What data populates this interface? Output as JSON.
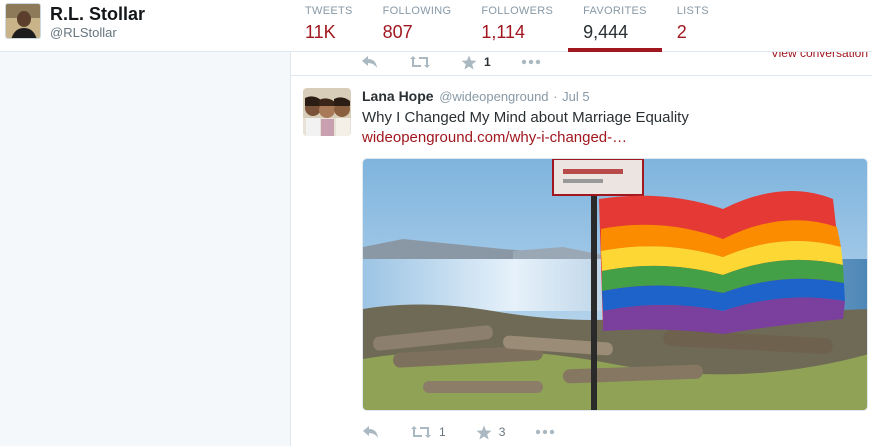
{
  "profile": {
    "name": "R.L. Stollar",
    "handle": "@RLStollar"
  },
  "stats": [
    {
      "label": "TWEETS",
      "value": "11K",
      "active": false
    },
    {
      "label": "FOLLOWING",
      "value": "807",
      "active": false
    },
    {
      "label": "FOLLOWERS",
      "value": "1,114",
      "active": false
    },
    {
      "label": "FAVORITES",
      "value": "9,444",
      "active": true
    },
    {
      "label": "LISTS",
      "value": "2",
      "active": false
    }
  ],
  "previous_tweet": {
    "favorite_count": "1",
    "view_conversation": "View conversation"
  },
  "tweet": {
    "fullname": "Lana Hope",
    "username": "@wideopenground",
    "separator": "·",
    "time": "Jul 5",
    "text": "Why I Changed My Mind about Marriage Equality",
    "link": "wideopenground.com/why-i-changed-…",
    "retweet_count": "1",
    "favorite_count": "3"
  },
  "icons": {
    "reply": "reply-icon",
    "retweet": "retweet-icon",
    "favorite": "star-icon",
    "more": "more-dots-icon"
  },
  "colors": {
    "accent": "#a0171f",
    "muted": "#8899a6",
    "icon": "#aab8c2"
  }
}
